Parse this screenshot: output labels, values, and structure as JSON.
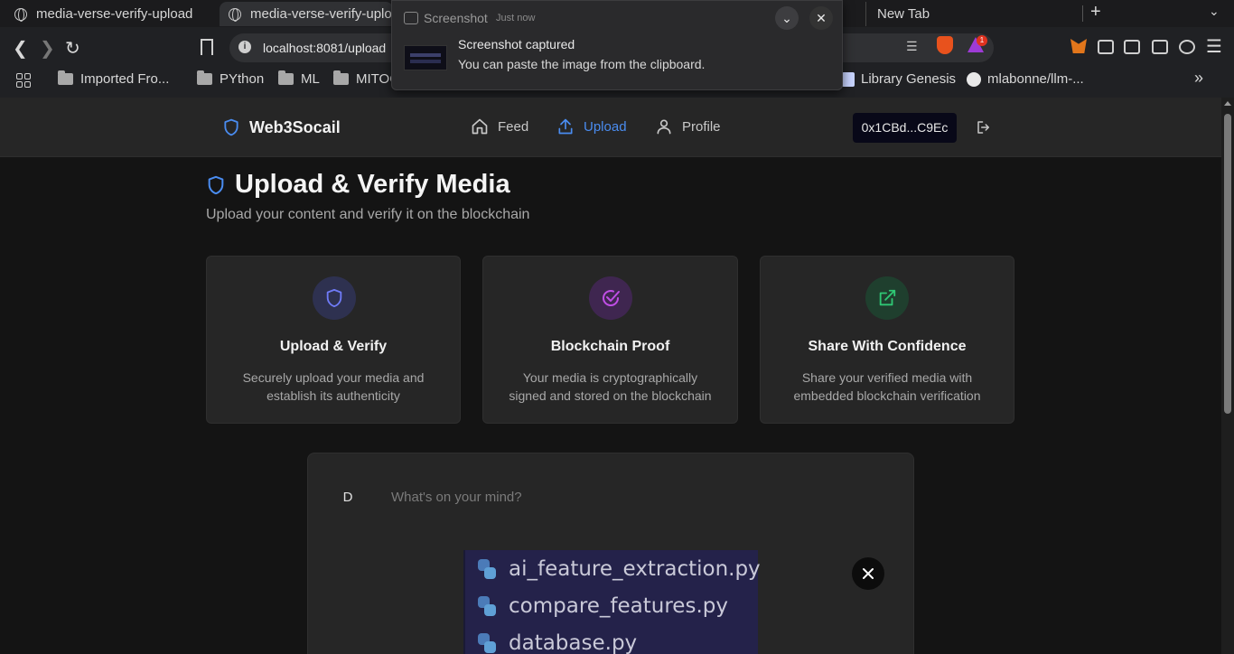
{
  "browser": {
    "tabs": [
      {
        "label": "media-verse-verify-upload"
      },
      {
        "label": "media-verse-verify-uplo"
      },
      {
        "label": "New Tab"
      }
    ],
    "url": "localhost:8081/upload",
    "bookmarks": [
      {
        "label": "Imported Fro..."
      },
      {
        "label": "PYthon"
      },
      {
        "label": "ML"
      },
      {
        "label": "MITOC"
      },
      {
        "label": "Library Genesis"
      },
      {
        "label": "mlabonne/llm-..."
      }
    ],
    "notification_badge": "1",
    "overflow": "»"
  },
  "notification": {
    "app": "Screenshot",
    "time": "Just now",
    "title": "Screenshot captured",
    "body": "You can paste the image from the clipboard."
  },
  "header": {
    "brand": "Web3Socail",
    "nav": [
      {
        "label": "Feed"
      },
      {
        "label": "Upload"
      },
      {
        "label": "Profile"
      }
    ],
    "wallet": "0x1CBd...C9Ec"
  },
  "page": {
    "title": "Upload & Verify Media",
    "subtitle": "Upload your content and verify it on the blockchain"
  },
  "features": [
    {
      "title": "Upload & Verify",
      "desc": "Securely upload your media and establish its authenticity",
      "icon": "shield-icon",
      "color": "#6f7bf7"
    },
    {
      "title": "Blockchain Proof",
      "desc": "Your media is cryptographically signed and stored on the blockchain",
      "icon": "check-circle-icon",
      "color": "#c04ee6"
    },
    {
      "title": "Share With Confidence",
      "desc": "Share your verified media with embedded blockchain verification",
      "icon": "external-link-icon",
      "color": "#2fc774"
    }
  ],
  "composer": {
    "avatar": "D",
    "placeholder": "What's on your mind?",
    "files": [
      {
        "name": "ai_feature_extraction.py"
      },
      {
        "name": "compare_features.py"
      },
      {
        "name": "database.py"
      }
    ]
  },
  "colors": {
    "accent": "#4a8cf0",
    "background": "#141414",
    "card": "#262626"
  }
}
